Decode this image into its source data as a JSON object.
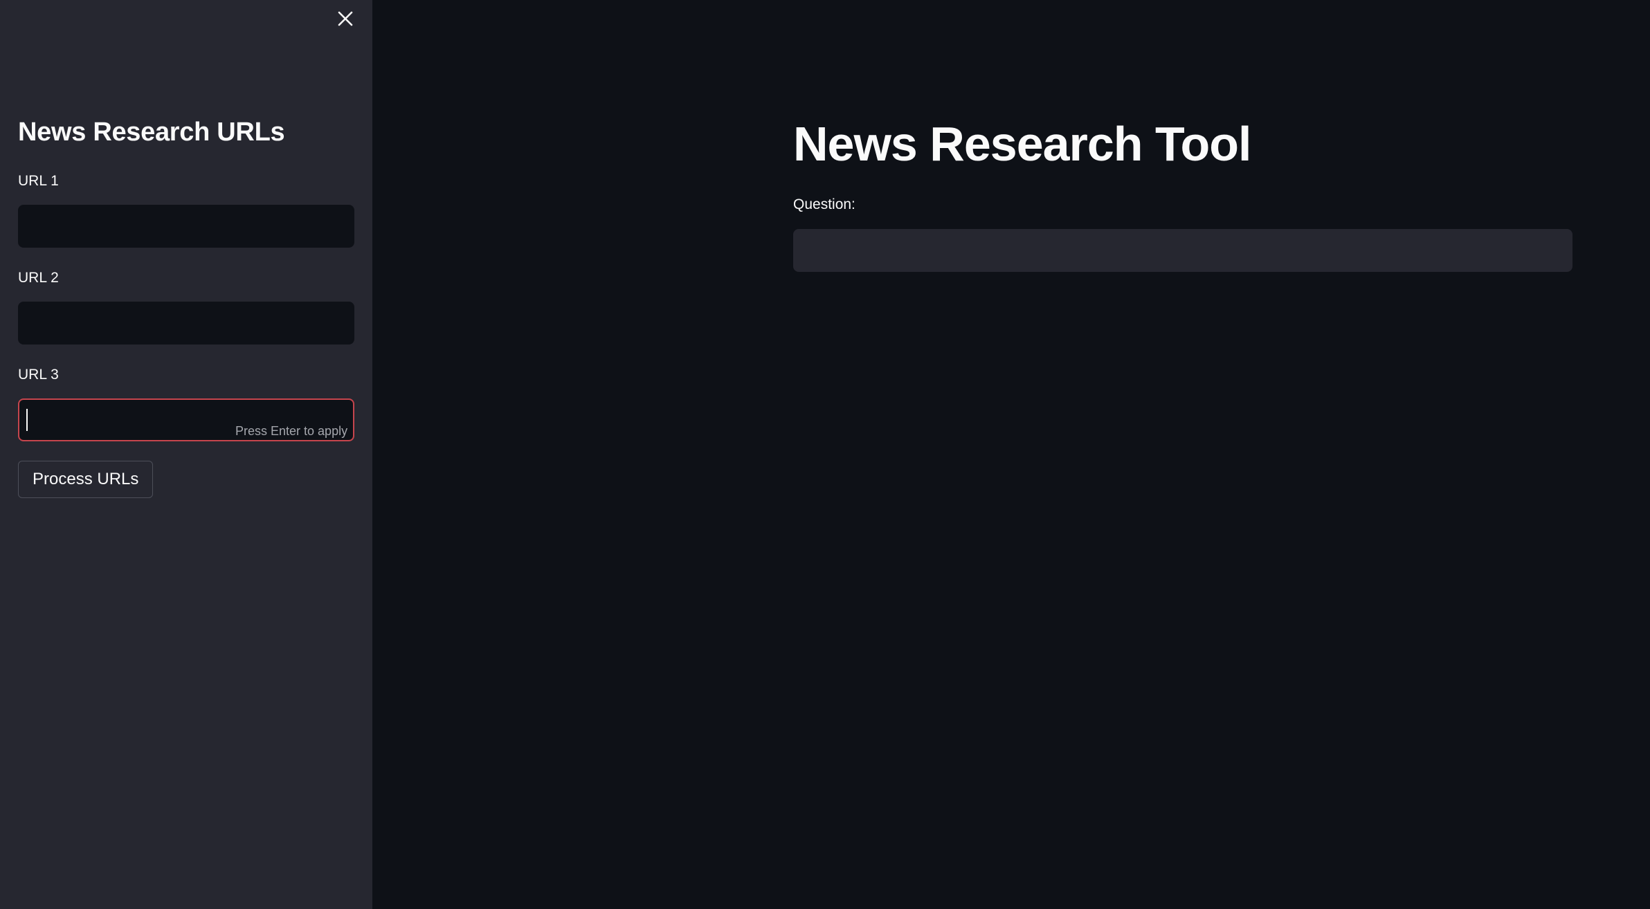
{
  "sidebar": {
    "title": "News Research URLs",
    "fields": [
      {
        "label": "URL 1",
        "value": ""
      },
      {
        "label": "URL 2",
        "value": ""
      },
      {
        "label": "URL 3",
        "value": "",
        "hint": "Press Enter to apply"
      }
    ],
    "process_button_label": "Process URLs",
    "close_icon": "close-icon"
  },
  "main": {
    "title": "News Research Tool",
    "question_label": "Question:",
    "question_value": ""
  },
  "colors": {
    "sidebar_bg": "#262730",
    "main_bg": "#0e1117",
    "focus_border": "#c6454d",
    "text": "#fafafa"
  }
}
